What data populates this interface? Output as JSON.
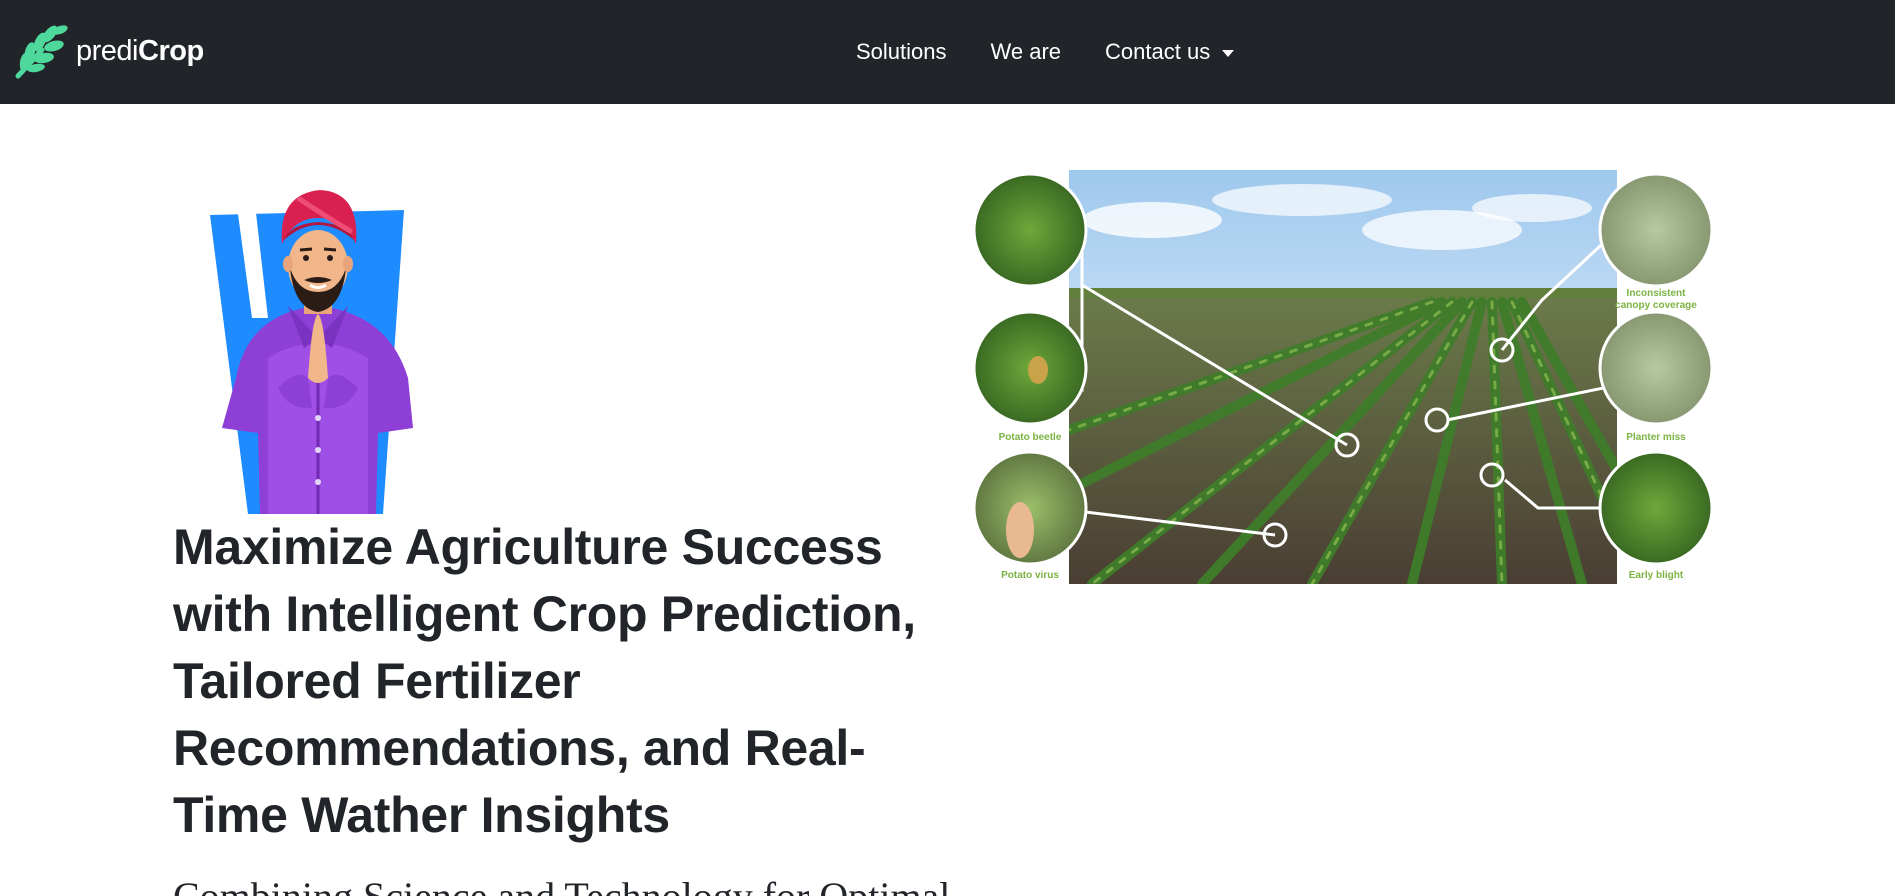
{
  "brand": {
    "name_part1": "predi",
    "name_part2": "Crop",
    "logo_icon": "wheat-leaf-icon",
    "logo_color": "#4fd89b"
  },
  "nav": {
    "items": [
      {
        "label": "Solutions"
      },
      {
        "label": "We are"
      },
      {
        "label": "Contact us",
        "dropdown": true
      }
    ]
  },
  "hero": {
    "headline": "Maximize Agriculture Success with Intelligent Crop Prediction, Tailored Fertilizer Recommendations, and Real-Time Wather Insights",
    "subtext": "Combining Science and Technology for Optimal",
    "illustration": "farmer-greeting-illustration",
    "field_image": {
      "labels": {
        "top_right": [
          "Inconsistent",
          "canopy coverage"
        ],
        "mid_left": "Potato beetle",
        "mid_right": "Planter miss",
        "bottom_left": "Potato virus",
        "bottom_right": "Early blight"
      }
    }
  },
  "colors": {
    "navbar_bg": "#212529",
    "text": "#212529",
    "label_green": "#7cb342"
  }
}
